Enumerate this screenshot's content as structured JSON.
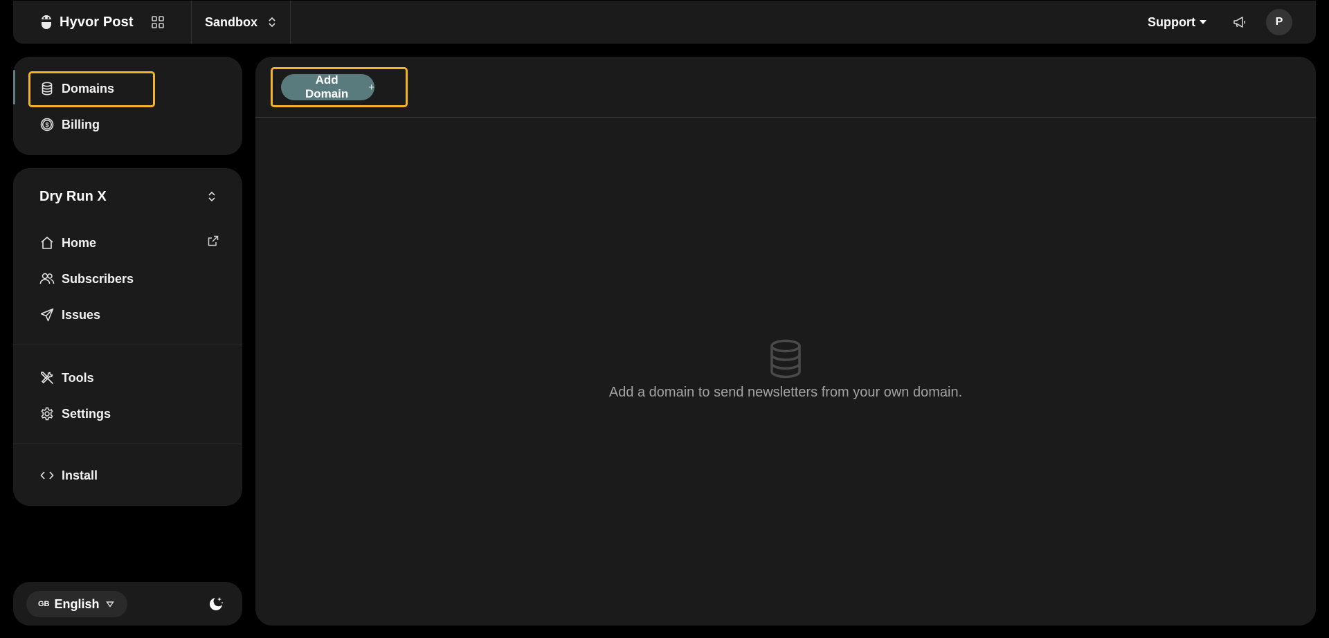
{
  "topbar": {
    "brand": "Hyvor Post",
    "project": "Sandbox",
    "support": "Support",
    "avatar_initial": "P"
  },
  "sidebar": {
    "top_items": [
      {
        "label": "Domains",
        "icon": "database-icon",
        "active": true
      },
      {
        "label": "Billing",
        "icon": "dollar-circle-icon",
        "active": false
      }
    ],
    "workspace": "Dry Run X",
    "nav_items": [
      {
        "label": "Home",
        "icon": "home-icon"
      },
      {
        "label": "Subscribers",
        "icon": "users-icon"
      },
      {
        "label": "Issues",
        "icon": "send-icon"
      },
      {
        "label": "Tools",
        "icon": "tools-icon"
      },
      {
        "label": "Settings",
        "icon": "gear-icon"
      },
      {
        "label": "Install",
        "icon": "code-icon"
      }
    ],
    "language": {
      "flag": "GB",
      "label": "English"
    }
  },
  "main": {
    "add_button": "Add Domain",
    "add_button_icon": "+",
    "empty_message": "Add a domain to send newsletters from your own domain."
  },
  "colors": {
    "background": "#000000",
    "panel": "#1b1b1b",
    "accent": "#5a7b7e",
    "highlight": "#f4b324",
    "muted_text": "#a3a3a3"
  }
}
